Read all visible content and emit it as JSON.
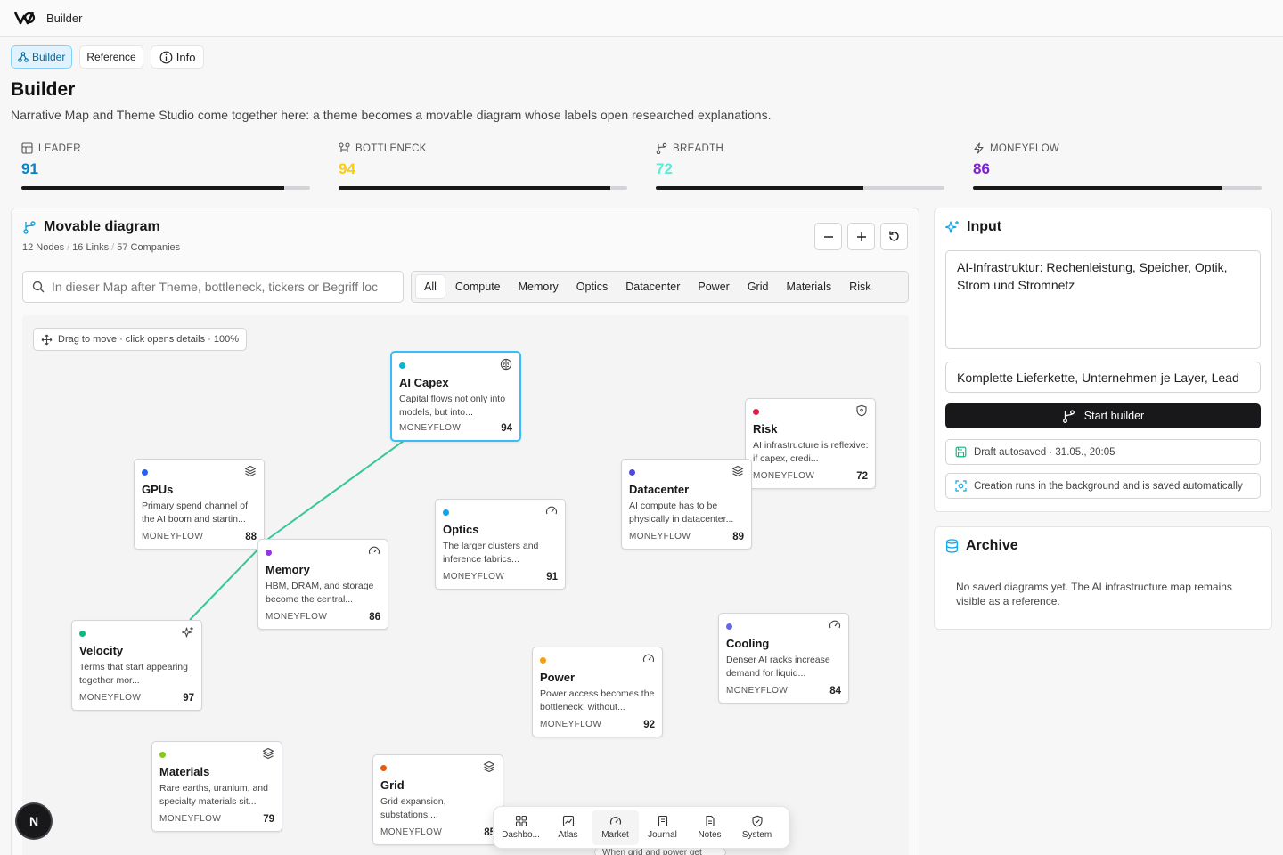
{
  "app": {
    "title": "Builder"
  },
  "tabs": [
    {
      "label": "Builder"
    },
    {
      "label": "Reference"
    },
    {
      "label": "Info"
    }
  ],
  "page": {
    "title": "Builder",
    "description": "Narrative Map and Theme Studio come together here: a theme becomes a movable diagram whose labels open researched explanations."
  },
  "metrics": [
    {
      "label": "LEADER",
      "value": "91",
      "progress": 0.91,
      "color": "#0284c7",
      "icon": "network-icon"
    },
    {
      "label": "BOTTLENECK",
      "value": "94",
      "progress": 0.94,
      "color": "#facc15",
      "icon": "funnel-icon"
    },
    {
      "label": "BREADTH",
      "value": "72",
      "progress": 0.72,
      "color": "#5eead4",
      "icon": "branch-icon"
    },
    {
      "label": "MONEYFLOW",
      "value": "86",
      "progress": 0.86,
      "color": "#7e22ce",
      "icon": "bolt-icon"
    }
  ],
  "diagram": {
    "title": "Movable diagram",
    "stats": {
      "nodes": "12 Nodes",
      "links": "16 Links",
      "companies": "57 Companies"
    },
    "search_placeholder": "In dieser Map after Theme, bottleneck, tickers or Begriff loc",
    "filters": [
      "All",
      "Compute",
      "Memory",
      "Optics",
      "Datacenter",
      "Power",
      "Grid",
      "Materials",
      "Risk"
    ],
    "active_filter": "All",
    "hint": "Drag to move · click opens details · 100%",
    "nodes": [
      {
        "id": "ai-capex",
        "title": "AI Capex",
        "desc": "Capital flows not only into models, but into...",
        "label": "MONEYFLOW",
        "score": "94",
        "dot": "#06b6d4",
        "icon": "brain-icon"
      },
      {
        "id": "risk",
        "title": "Risk",
        "desc": "AI infrastructure is reflexive: if capex, credi...",
        "label": "MONEYFLOW",
        "score": "72",
        "dot": "#e11d48",
        "icon": "shield-icon"
      },
      {
        "id": "gpus",
        "title": "GPUs",
        "desc": "Primary spend channel of the AI boom and startin...",
        "label": "MONEYFLOW",
        "score": "88",
        "dot": "#2563eb",
        "icon": "layers-icon"
      },
      {
        "id": "datacenter",
        "title": "Datacenter",
        "desc": "AI compute has to be physically in datacenter...",
        "label": "MONEYFLOW",
        "score": "89",
        "dot": "#4f46e5",
        "icon": "layers-icon"
      },
      {
        "id": "optics",
        "title": "Optics",
        "desc": "The larger clusters and inference fabrics...",
        "label": "MONEYFLOW",
        "score": "91",
        "dot": "#0ea5e9",
        "icon": "gauge-icon"
      },
      {
        "id": "memory",
        "title": "Memory",
        "desc": "HBM, DRAM, and storage become the central...",
        "label": "MONEYFLOW",
        "score": "86",
        "dot": "#9333ea",
        "icon": "gauge-icon"
      },
      {
        "id": "velocity",
        "title": "Velocity",
        "desc": "Terms that start appearing together mor...",
        "label": "MONEYFLOW",
        "score": "97",
        "dot": "#10b981",
        "icon": "sparkles-icon"
      },
      {
        "id": "cooling",
        "title": "Cooling",
        "desc": "Denser AI racks increase demand for liquid...",
        "label": "MONEYFLOW",
        "score": "84",
        "dot": "#6366f1",
        "icon": "gauge-icon"
      },
      {
        "id": "power",
        "title": "Power",
        "desc": "Power access becomes the bottleneck: without...",
        "label": "MONEYFLOW",
        "score": "92",
        "dot": "#f59e0b",
        "icon": "gauge-icon"
      },
      {
        "id": "materials",
        "title": "Materials",
        "desc": "Rare earths, uranium, and specialty materials sit...",
        "label": "MONEYFLOW",
        "score": "79",
        "dot": "#84cc16",
        "icon": "layers-icon"
      },
      {
        "id": "grid",
        "title": "Grid",
        "desc": "Grid expansion, substations,...",
        "label": "MONEYFLOW",
        "score": "85",
        "dot": "#ea580c",
        "icon": "layers-icon"
      }
    ],
    "link_color": "#34c79a"
  },
  "input": {
    "title": "Input",
    "textarea_value": "AI-Infrastruktur: Rechenleistung, Speicher, Optik, Strom und Stromnetz",
    "line_value": "Komplette Lieferkette, Unternehmen je Layer, Lead",
    "start_label": "Start builder",
    "autosave": "Draft autosaved · 31.05., 20:05",
    "background_note": "Creation runs in the background and is saved automatically"
  },
  "archive": {
    "title": "Archive",
    "empty_text": "No saved diagrams yet. The AI infrastructure map remains visible as a reference."
  },
  "dock": [
    {
      "label": "Dashbo...",
      "icon": "grid-icon"
    },
    {
      "label": "Atlas",
      "icon": "chart-icon"
    },
    {
      "label": "Market",
      "icon": "gauge-icon"
    },
    {
      "label": "Journal",
      "icon": "journal-icon"
    },
    {
      "label": "Notes",
      "icon": "notes-icon"
    },
    {
      "label": "System",
      "icon": "shield-icon"
    }
  ],
  "dock_active": "Market",
  "dock_peek": "When grid and power get",
  "badge": "N"
}
